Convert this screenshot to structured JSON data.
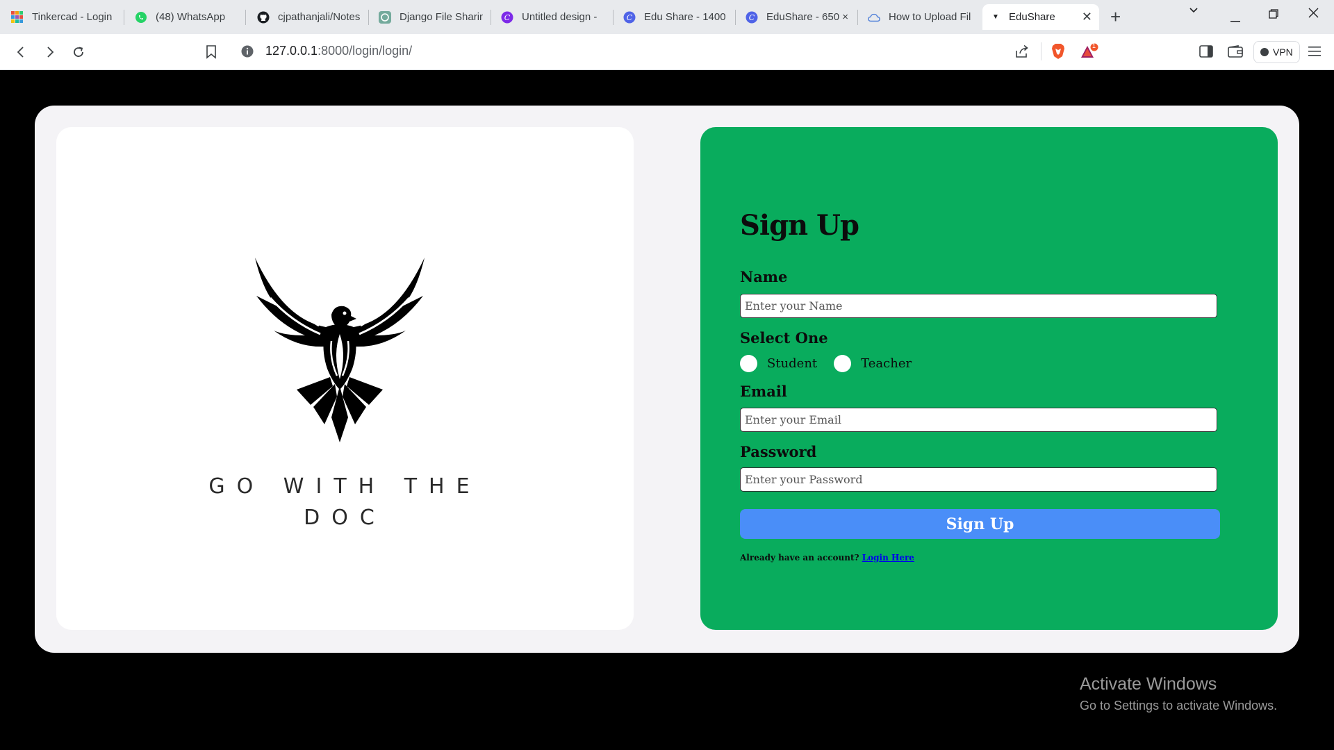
{
  "browser": {
    "tabs": [
      {
        "title": "Tinkercad - Login",
        "icon": "tinkercad-icon"
      },
      {
        "title": "(48) WhatsApp",
        "icon": "whatsapp-icon"
      },
      {
        "title": "cjpathanjali/Notes",
        "icon": "github-icon"
      },
      {
        "title": "Django File Sharin",
        "icon": "chatgpt-icon"
      },
      {
        "title": "Untitled design - ",
        "icon": "canva-icon"
      },
      {
        "title": "Edu Share - 1400",
        "icon": "canva-icon"
      },
      {
        "title": "EduShare - 650 ×",
        "icon": "canva-icon"
      },
      {
        "title": "How to Upload Fil",
        "icon": "cloud-icon"
      },
      {
        "title": "EduShare",
        "icon": "dropdown-icon",
        "active": true
      }
    ],
    "url_host": "127.0.0.1",
    "url_path": ":8000/login/login/",
    "vpn_label": "VPN",
    "brave_badge": "1"
  },
  "logo": {
    "tagline_line1": "GO WITH THE",
    "tagline_line2": "DOC"
  },
  "form": {
    "title": "Sign Up",
    "name_label": "Name",
    "name_placeholder": "Enter your Name",
    "role_label": "Select One",
    "role_options": [
      "Student",
      "Teacher"
    ],
    "email_label": "Email",
    "email_placeholder": "Enter your Email",
    "password_label": "Password",
    "password_placeholder": "Enter your Password",
    "submit_label": "Sign Up",
    "already_text": "Already have an account?",
    "login_link": "Login Here"
  },
  "watermark": {
    "line1": "Activate Windows",
    "line2": "Go to Settings to activate Windows."
  },
  "colors": {
    "form_bg": "#09ac5d",
    "button_bg": "#4a8ef8",
    "link": "#0000ee"
  }
}
